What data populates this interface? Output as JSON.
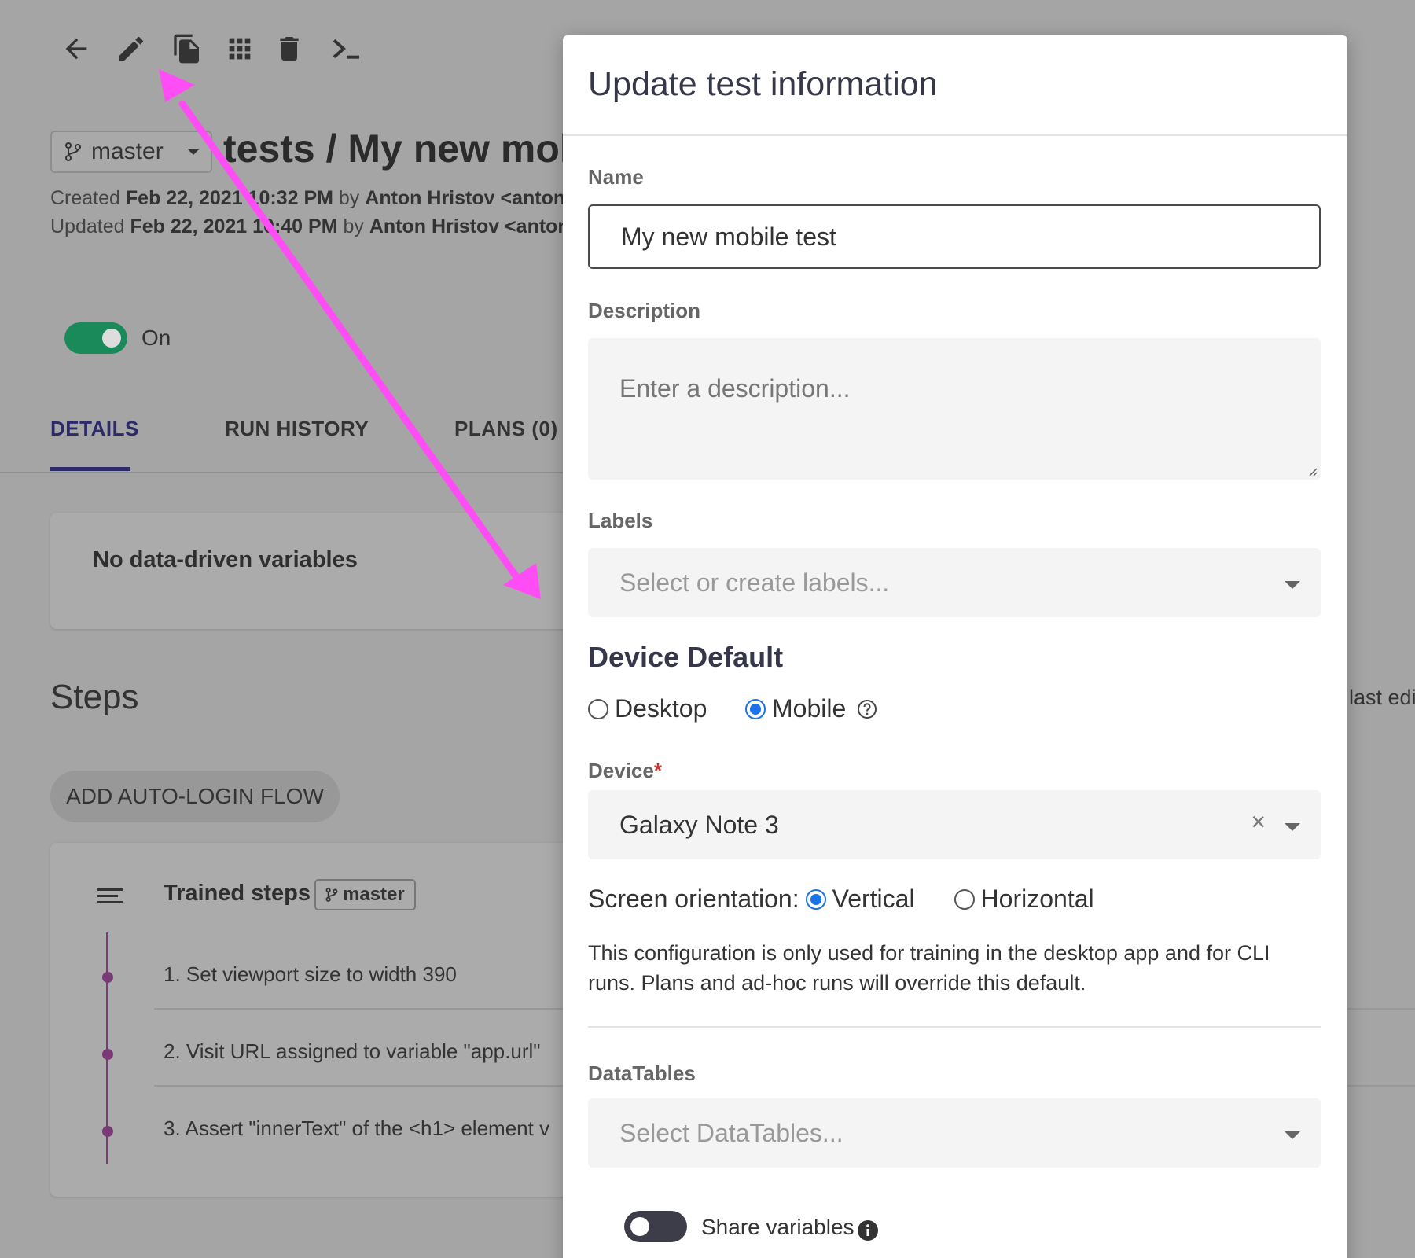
{
  "toolbar": {
    "icons": [
      "back-arrow-icon",
      "edit-pencil-icon",
      "duplicate-icon",
      "grid-icon",
      "trash-icon",
      "terminal-icon"
    ]
  },
  "header": {
    "branch": "master",
    "title": "tests / My new mol",
    "created_prefix": "Created",
    "created_date": "Feb 22, 2021 10:32 PM",
    "created_by_word": "by",
    "created_by": "Anton Hristov <anton@",
    "updated_prefix": "Updated",
    "updated_date": "Feb 22, 2021 10:40 PM",
    "updated_by_word": "by",
    "updated_by": "Anton Hristov <anton@"
  },
  "toggle": {
    "label": "On",
    "state": "on"
  },
  "tabs": [
    {
      "label": "DETAILS",
      "active": true
    },
    {
      "label": "RUN HISTORY",
      "active": false
    },
    {
      "label": "PLANS (0)",
      "active": false
    }
  ],
  "variables_card": {
    "text": "No data-driven variables"
  },
  "steps": {
    "title": "Steps",
    "last_edit": "last edi",
    "auto_login_button": "ADD AUTO-LOGIN FLOW",
    "trained_label": "Trained steps",
    "branch_chip": "master",
    "items": [
      "1. Set viewport size to width 390",
      "2. Visit URL assigned to variable \"app.url\"",
      "3. Assert \"innerText\" of the <h1> element v"
    ]
  },
  "modal": {
    "title": "Update test information",
    "name_label": "Name",
    "name_value": "My new mobile test",
    "description_label": "Description",
    "description_placeholder": "Enter a description...",
    "labels_label": "Labels",
    "labels_placeholder": "Select or create labels...",
    "device_default_title": "Device Default",
    "device_options": [
      {
        "label": "Desktop",
        "checked": false
      },
      {
        "label": "Mobile",
        "checked": true
      }
    ],
    "device_label": "Device",
    "device_required": "*",
    "device_value": "Galaxy Note 3",
    "orientation_label": "Screen orientation:",
    "orientation_options": [
      {
        "label": "Vertical",
        "checked": true
      },
      {
        "label": "Horizontal",
        "checked": false
      }
    ],
    "note": "This configuration is only used for training in the desktop app and for CLI runs. Plans and ad-hoc runs will override this default.",
    "datatables_label": "DataTables",
    "datatables_placeholder": "Select DataTables...",
    "share_variables_label": "Share variables",
    "share_variables_state": "off"
  },
  "colors": {
    "annotation_arrow": "#ff4df5",
    "accent_blue": "#1a73e8",
    "toggle_on": "#1b8a5a",
    "active_tab": "#2d2a6b",
    "timeline": "#7a3a78"
  }
}
